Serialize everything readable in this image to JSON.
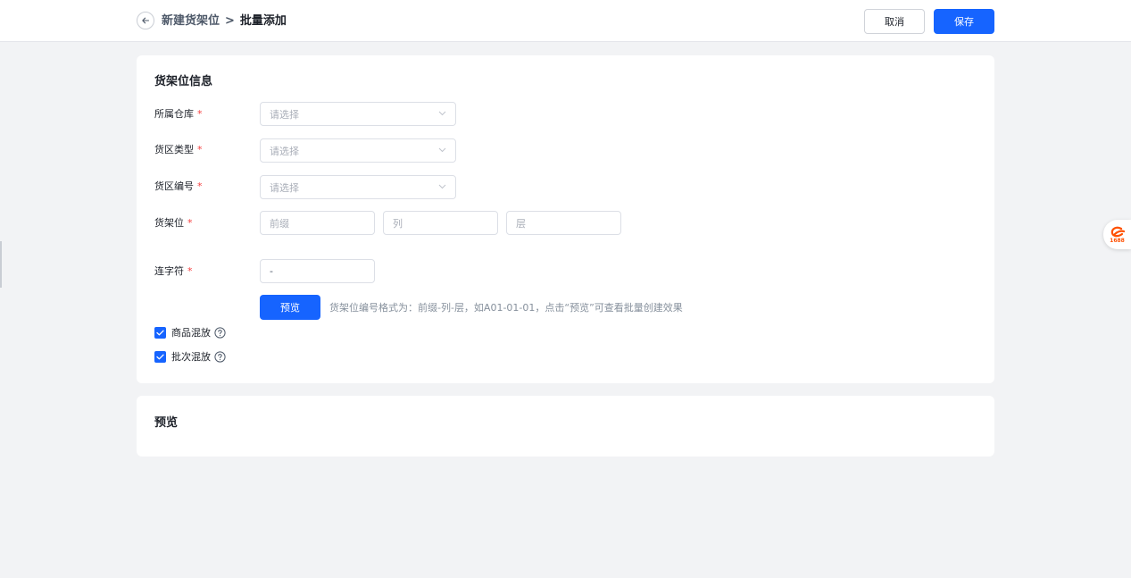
{
  "header": {
    "breadcrumb_parent": "新建货架位",
    "breadcrumb_separator": ">",
    "breadcrumb_current": "批量添加",
    "cancel_label": "取消",
    "save_label": "保存"
  },
  "info_card": {
    "title": "货架位信息",
    "required_mark": "*",
    "warehouse": {
      "label": "所属仓库",
      "placeholder": "请选择"
    },
    "zone_type": {
      "label": "货区类型",
      "placeholder": "请选择"
    },
    "zone_code": {
      "label": "货区编号",
      "placeholder": "请选择"
    },
    "shelf": {
      "label": "货架位",
      "prefix_placeholder": "前缀",
      "column_placeholder": "列",
      "layer_placeholder": "层"
    },
    "connector": {
      "label": "连字符",
      "value": "-"
    },
    "preview_button": "预览",
    "hint": "货架位编号格式为：前缀-列-层，如A01-01-01，点击“预览”可查看批量创建效果",
    "mix_goods": {
      "label": "商品混放",
      "checked": true
    },
    "mix_batch": {
      "label": "批次混放",
      "checked": true
    }
  },
  "preview_card": {
    "title": "预览"
  },
  "side_widget": {
    "logo_text": "1688"
  },
  "colors": {
    "primary": "#1664ff",
    "required": "#f53f3f",
    "background": "#f2f3f5"
  }
}
